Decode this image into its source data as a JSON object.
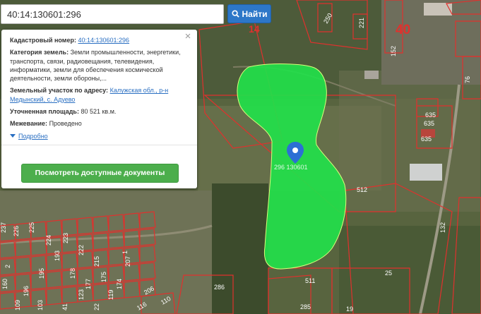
{
  "search": {
    "value": "40:14:130601:296",
    "button_label": "Найти"
  },
  "popup": {
    "cadastral_label": "Кадастровый номер:",
    "cadastral_value": "40:14:130601:296",
    "category_label": "Категория земель:",
    "category_value": "Земли промышленности, энергетики, транспорта, связи, радиовещания, телевидения, информатики, земли для обеспечения космической деятельности, земли обороны,...",
    "address_label": "Земельный участок по адресу:",
    "address_value": "Калужская обл., р-н Медынский, с. Адуево",
    "area_label": "Уточненная площадь:",
    "area_value": "80 521 кв.м.",
    "survey_label": "Межевание:",
    "survey_value": "Проведено",
    "details_label": "Подробно",
    "docs_button_label": "Посмотреть доступные документы"
  },
  "map": {
    "highlight_color": "#22e04a",
    "parcel_border_color": "#e0312d",
    "selected_parcel_label": "296 130601",
    "block_numbers": [
      "14",
      "40"
    ],
    "parcel_numbers": [
      "635",
      "635",
      "635",
      "512",
      "511",
      "286",
      "285",
      "25",
      "19",
      "132",
      "76",
      "152",
      "221",
      "250",
      "237",
      "226",
      "225",
      "224",
      "223",
      "222",
      "215",
      "207",
      "206",
      "196",
      "195",
      "193",
      "178",
      "177",
      "175",
      "174",
      "160",
      "123",
      "119",
      "116",
      "110",
      "109",
      "103",
      "41",
      "22",
      "1",
      "2"
    ]
  }
}
